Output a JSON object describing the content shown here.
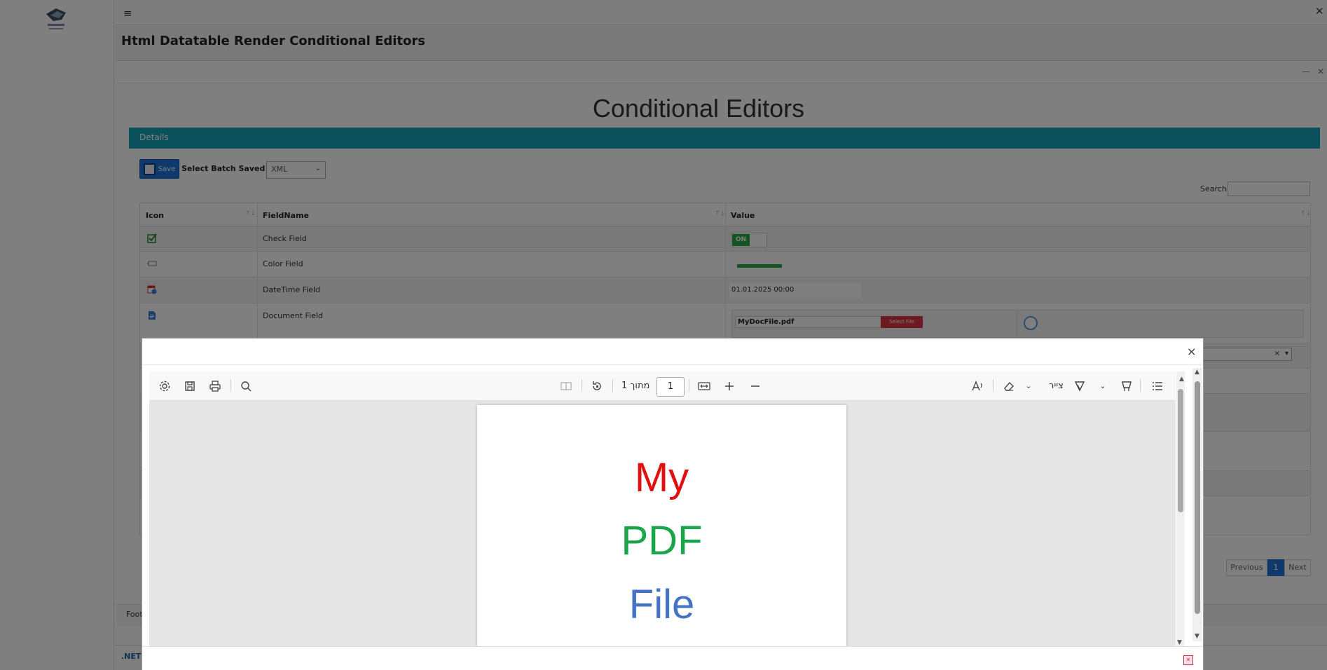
{
  "app": {
    "page_title": "Html Datatable Render Conditional Editors",
    "top_close": "✕",
    "hamburger": "≡"
  },
  "panel": {
    "min": "—",
    "close": "✕"
  },
  "main": {
    "heading": "Conditional Editors",
    "details_label": "Details",
    "save_label": "Save",
    "batch_label": "Select Batch Saved Way",
    "batch_value": "XML",
    "search_label": "Search:",
    "columns": [
      "Icon",
      "FieldName",
      "Value"
    ],
    "rows": [
      {
        "name": "Check Field",
        "icon": "checkbox-icon"
      },
      {
        "name": "Color Field",
        "icon": "color-field-icon"
      },
      {
        "name": "DateTime Field",
        "icon": "calendar-icon"
      },
      {
        "name": "Document Field",
        "icon": "document-icon"
      }
    ],
    "toggle_label": "ON",
    "datetime_value": "01.01.2025 00:00",
    "doc_filename": "MyDocFile.pdf",
    "select_file_label": "Select File",
    "dropdown_clear": "×",
    "dropdown_chevron": "▾",
    "pagination": {
      "prev": "Previous",
      "current": "1",
      "next": "Next"
    },
    "footer_label": "Foot",
    "bottom_link": ".NET I"
  },
  "modal": {
    "close": "×",
    "toolbar": {
      "page_of": "מתוך 1",
      "page_number": "1",
      "draw_label": "צייר"
    },
    "pdf_words": [
      {
        "text": "My",
        "color": "#e01010"
      },
      {
        "text": "PDF",
        "color": "#1aa54a"
      },
      {
        "text": "File",
        "color": "#4472c4"
      }
    ]
  },
  "colors": {
    "details_bar": "#17a2b8",
    "accent_blue": "#1e73d8",
    "toggle_green": "#28a745",
    "select_file_red": "#dc3545"
  }
}
